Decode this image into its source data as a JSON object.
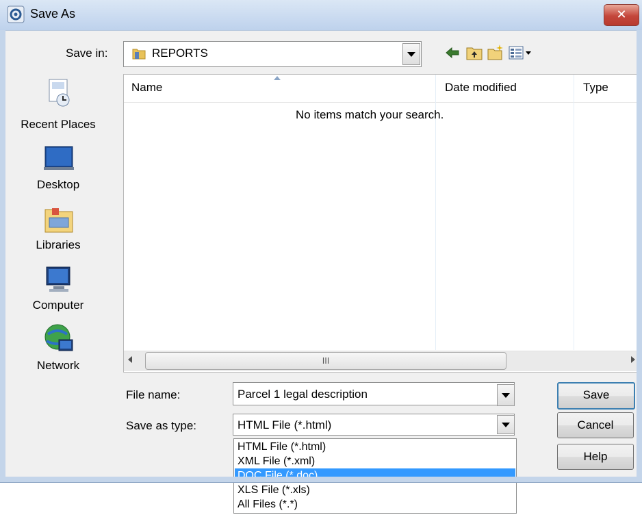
{
  "window": {
    "title": "Save As",
    "close_glyph": "✕"
  },
  "toolbar": {
    "save_in_label": "Save in:",
    "save_in_value": "REPORTS",
    "icons": [
      "back-icon",
      "up-folder-icon",
      "new-folder-icon",
      "views-menu-icon"
    ]
  },
  "places": [
    {
      "label": "Recent Places",
      "icon": "recent-places-icon"
    },
    {
      "label": "Desktop",
      "icon": "desktop-icon"
    },
    {
      "label": "Libraries",
      "icon": "libraries-icon"
    },
    {
      "label": "Computer",
      "icon": "computer-icon"
    },
    {
      "label": "Network",
      "icon": "network-icon"
    }
  ],
  "file_list": {
    "columns": [
      "Name",
      "Date modified",
      "Type"
    ],
    "empty_message": "No items match your search.",
    "scroll_thumb": "III"
  },
  "form": {
    "file_name_label": "File name:",
    "file_name_value": "Parcel 1 legal description",
    "save_as_type_label": "Save as type:",
    "save_as_type_value": "HTML File (*.html)",
    "type_options": [
      "HTML File (*.html)",
      "XML File (*.xml)",
      "DOC File (*.doc)",
      "XLS File (*.xls)",
      "All Files (*.*)"
    ],
    "selected_option": "DOC File (*.doc)"
  },
  "buttons": {
    "save": "Save",
    "cancel": "Cancel",
    "help": "Help"
  },
  "colors": {
    "selection": "#3399ff",
    "titlebar": "#c9daf0",
    "close": "#c4463b"
  }
}
